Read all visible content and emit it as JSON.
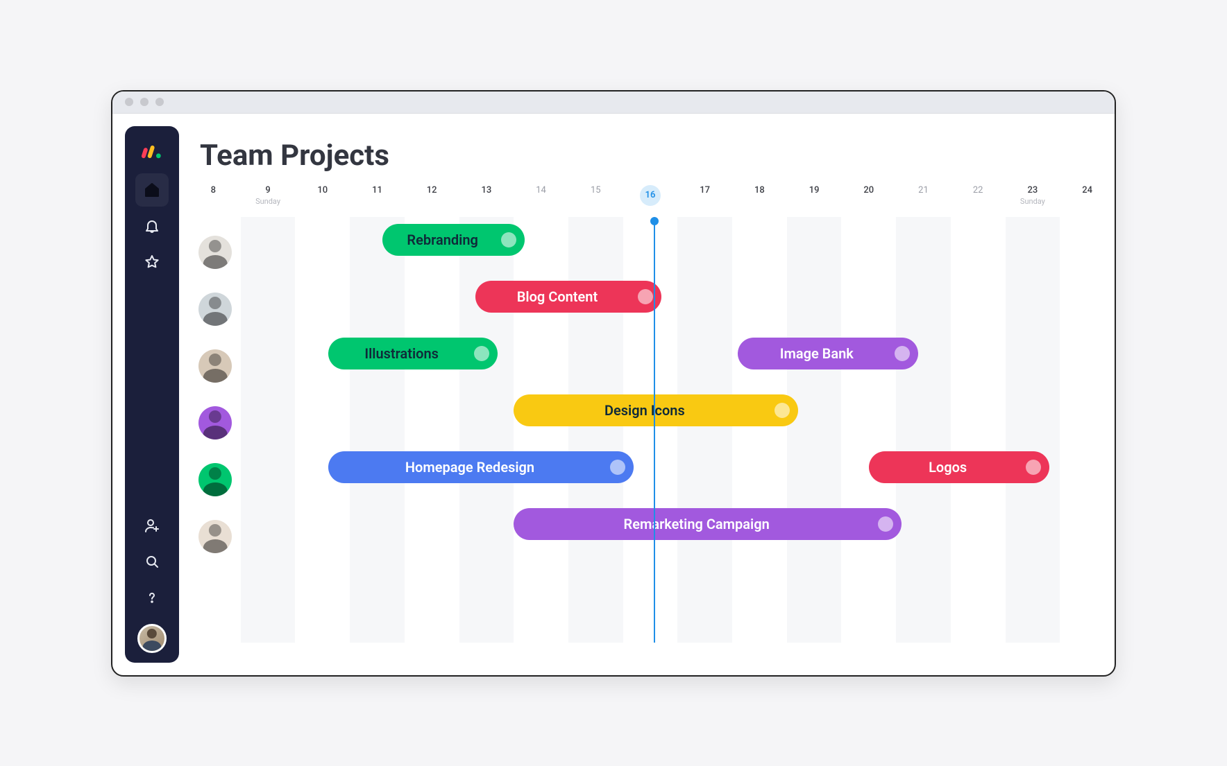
{
  "page": {
    "title": "Team Projects"
  },
  "sidebar": {
    "items": [
      {
        "name": "home-icon",
        "active": true
      },
      {
        "name": "bell-icon",
        "active": false
      },
      {
        "name": "star-icon",
        "active": false
      }
    ],
    "bottom_items": [
      {
        "name": "add-user-icon"
      },
      {
        "name": "search-icon"
      },
      {
        "name": "help-icon"
      }
    ]
  },
  "timeline": {
    "start_day": 8,
    "end_day": 24,
    "today": 16,
    "days": [
      {
        "num": "8",
        "dark": true
      },
      {
        "num": "9",
        "dark": true,
        "dow": "Sunday"
      },
      {
        "num": "10",
        "dark": true
      },
      {
        "num": "11",
        "dark": true
      },
      {
        "num": "12",
        "dark": true
      },
      {
        "num": "13",
        "dark": true
      },
      {
        "num": "14"
      },
      {
        "num": "15"
      },
      {
        "num": "16",
        "today": true
      },
      {
        "num": "17",
        "dark": true
      },
      {
        "num": "18",
        "dark": true
      },
      {
        "num": "19",
        "dark": true
      },
      {
        "num": "20",
        "dark": true
      },
      {
        "num": "21"
      },
      {
        "num": "22"
      },
      {
        "num": "23",
        "dark": true,
        "dow": "Sunday"
      },
      {
        "num": "24",
        "dark": true
      }
    ]
  },
  "colors": {
    "green": "#00c66f",
    "red": "#ed3558",
    "purple": "#a259de",
    "yellow": "#f9c912",
    "blue": "#4c7af1"
  },
  "rows": [
    {
      "avatar_bg": "#e4e1dc",
      "bars": [
        {
          "label": "Rebranding",
          "start": 11.6,
          "end": 14.2,
          "color": "green"
        }
      ]
    },
    {
      "avatar_bg": "#cfd6da",
      "bars": [
        {
          "label": "Blog Content",
          "start": 13.3,
          "end": 16.7,
          "color": "red"
        }
      ]
    },
    {
      "avatar_bg": "#d7c9b8",
      "bars": [
        {
          "label": "Illustrations",
          "start": 10.6,
          "end": 13.7,
          "color": "green"
        },
        {
          "label": "Image Bank",
          "start": 18.1,
          "end": 21.4,
          "color": "purple"
        }
      ]
    },
    {
      "avatar_bg": "#a259de",
      "bars": [
        {
          "label": "Design Icons",
          "start": 14.0,
          "end": 19.2,
          "color": "yellow"
        }
      ]
    },
    {
      "avatar_bg": "#00c66f",
      "bars": [
        {
          "label": "Homepage Redesign",
          "start": 10.6,
          "end": 16.2,
          "color": "blue"
        },
        {
          "label": "Logos",
          "start": 20.5,
          "end": 23.8,
          "color": "red"
        }
      ]
    },
    {
      "avatar_bg": "#e9dfd4",
      "bars": [
        {
          "label": "Remarketing Campaign",
          "start": 14.0,
          "end": 21.1,
          "color": "purple"
        }
      ]
    }
  ],
  "chart_data": {
    "type": "gantt",
    "title": "Team Projects",
    "x_axis": {
      "unit": "day",
      "range": [
        8,
        24
      ],
      "today": 16
    },
    "series": [
      {
        "row": 0,
        "label": "Rebranding",
        "start": 11.6,
        "end": 14.2,
        "color": "#00c66f"
      },
      {
        "row": 1,
        "label": "Blog Content",
        "start": 13.3,
        "end": 16.7,
        "color": "#ed3558"
      },
      {
        "row": 2,
        "label": "Illustrations",
        "start": 10.6,
        "end": 13.7,
        "color": "#00c66f"
      },
      {
        "row": 2,
        "label": "Image Bank",
        "start": 18.1,
        "end": 21.4,
        "color": "#a259de"
      },
      {
        "row": 3,
        "label": "Design Icons",
        "start": 14.0,
        "end": 19.2,
        "color": "#f9c912"
      },
      {
        "row": 4,
        "label": "Homepage Redesign",
        "start": 10.6,
        "end": 16.2,
        "color": "#4c7af1"
      },
      {
        "row": 4,
        "label": "Logos",
        "start": 20.5,
        "end": 23.8,
        "color": "#ed3558"
      },
      {
        "row": 5,
        "label": "Remarketing Campaign",
        "start": 14.0,
        "end": 21.1,
        "color": "#a259de"
      }
    ]
  }
}
